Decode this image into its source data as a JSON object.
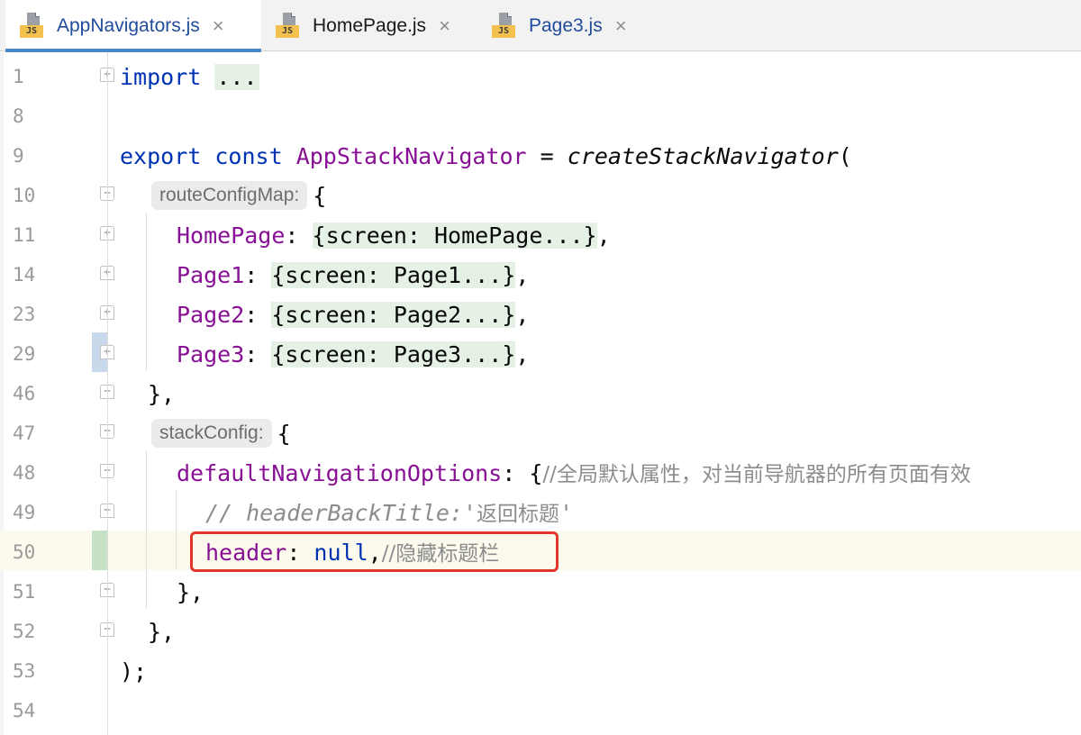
{
  "tabs": [
    {
      "name": "AppNavigators.js",
      "icon": "js-file-icon",
      "icon_label": "JS",
      "active": true
    },
    {
      "name": "HomePage.js",
      "icon": "js-file-icon",
      "icon_label": "JS",
      "active": false
    },
    {
      "name": "Page3.js",
      "icon": "js-file-icon",
      "icon_label": "JS",
      "active": false
    }
  ],
  "close_glyph": "×",
  "fold_glyphs": {
    "expand": "+",
    "collapse": "−"
  },
  "lines": [
    {
      "num": "1"
    },
    {
      "num": "8"
    },
    {
      "num": "9"
    },
    {
      "num": "10"
    },
    {
      "num": "11"
    },
    {
      "num": "14"
    },
    {
      "num": "23"
    },
    {
      "num": "29"
    },
    {
      "num": "46"
    },
    {
      "num": "47"
    },
    {
      "num": "48"
    },
    {
      "num": "49"
    },
    {
      "num": "50"
    },
    {
      "num": "51"
    },
    {
      "num": "52"
    },
    {
      "num": "53"
    },
    {
      "num": "54"
    }
  ],
  "code": {
    "l1_kw": "import",
    "l1_fold": "...",
    "l9_kw1": "export",
    "l9_kw2": "const",
    "l9_name": "AppStackNavigator",
    "l9_eq": " = ",
    "l9_fn": "createStackNavigator",
    "l9_paren": "(",
    "l10_hint": "routeConfigMap:",
    "l10_brace": "{",
    "l11_prop": "HomePage",
    "l11_colon": ": ",
    "l11_fold": "{screen: HomePage...}",
    "l11_end": ",",
    "l14_prop": "Page1",
    "l14_colon": ": ",
    "l14_fold": "{screen: Page1...}",
    "l14_end": ",",
    "l23_prop": "Page2",
    "l23_colon": ": ",
    "l23_fold": "{screen: Page2...}",
    "l23_end": ",",
    "l29_prop": "Page3",
    "l29_colon": ": ",
    "l29_fold": "{screen: Page3...}",
    "l29_end": ",",
    "l46_text": "},",
    "l47_hint": "stackConfig:",
    "l47_brace": "{",
    "l48_prop": "defaultNavigationOptions",
    "l48_rest": ": {",
    "l48_comment": "//全局默认属性，对当前导航器的所有页面有效",
    "l49_comment": "// headerBackTitle:'",
    "l49_comment_cn": "返回标题",
    "l49_comment_end": "'",
    "l50_prop": "header",
    "l50_colon": ": ",
    "l50_kw": "null",
    "l50_comma": ",",
    "l50_comment": "//隐藏标题栏",
    "l51_text": "},",
    "l52_text": "},",
    "l53_text": ");"
  },
  "colors": {
    "keyword": "#0033b3",
    "property": "#871094",
    "comment": "#8c8c8c",
    "fold_bg": "#e4f1e4",
    "highlight_box": "#e0362b",
    "current_line": "#fcfaed",
    "tab_underline": "#4a88c7"
  }
}
